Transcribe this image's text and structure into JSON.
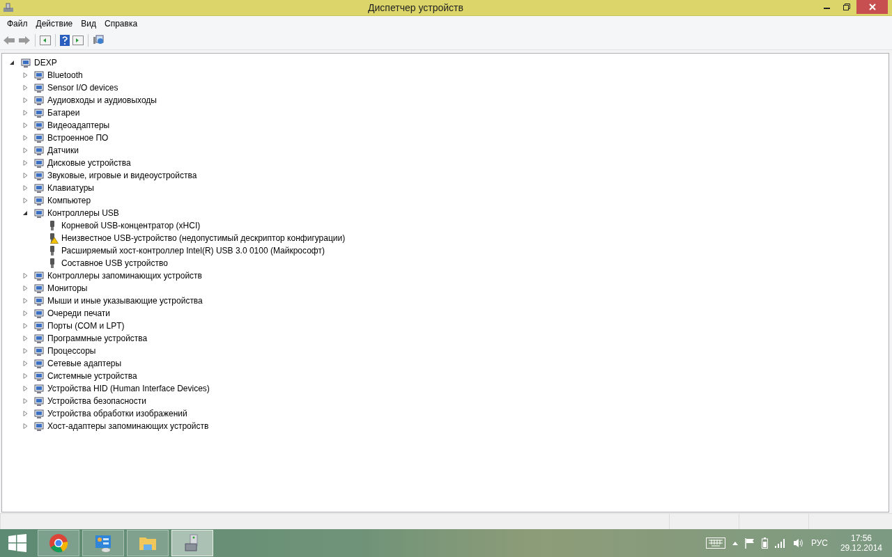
{
  "window": {
    "title": "Диспетчер устройств"
  },
  "menu": [
    "Файл",
    "Действие",
    "Вид",
    "Справка"
  ],
  "tree": {
    "label": "DEXP",
    "expanded": true,
    "children": [
      {
        "label": "Bluetooth",
        "expanded": false
      },
      {
        "label": "Sensor I/O devices",
        "expanded": false
      },
      {
        "label": "Аудиовходы и аудиовыходы",
        "expanded": false
      },
      {
        "label": "Батареи",
        "expanded": false
      },
      {
        "label": "Видеоадаптеры",
        "expanded": false
      },
      {
        "label": "Встроенное ПО",
        "expanded": false
      },
      {
        "label": "Датчики",
        "expanded": false
      },
      {
        "label": "Дисковые устройства",
        "expanded": false
      },
      {
        "label": "Звуковые, игровые и видеоустройства",
        "expanded": false
      },
      {
        "label": "Клавиатуры",
        "expanded": false
      },
      {
        "label": "Компьютер",
        "expanded": false
      },
      {
        "label": "Контроллеры USB",
        "expanded": true,
        "children": [
          {
            "label": "Корневой USB-концентратор (xHCI)",
            "warning": false
          },
          {
            "label": "Неизвестное USB-устройство (недопустимый дескриптор конфигурации)",
            "warning": true
          },
          {
            "label": "Расширяемый хост-контроллер Intel(R) USB 3.0 0100 (Майкрософт)",
            "warning": false
          },
          {
            "label": "Составное USB устройство",
            "warning": false
          }
        ]
      },
      {
        "label": "Контроллеры запоминающих устройств",
        "expanded": false
      },
      {
        "label": "Мониторы",
        "expanded": false
      },
      {
        "label": "Мыши и иные указывающие устройства",
        "expanded": false
      },
      {
        "label": "Очереди печати",
        "expanded": false
      },
      {
        "label": "Порты (COM и LPT)",
        "expanded": false
      },
      {
        "label": "Программные устройства",
        "expanded": false
      },
      {
        "label": "Процессоры",
        "expanded": false
      },
      {
        "label": "Сетевые адаптеры",
        "expanded": false
      },
      {
        "label": "Системные устройства",
        "expanded": false
      },
      {
        "label": "Устройства HID (Human Interface Devices)",
        "expanded": false
      },
      {
        "label": "Устройства безопасности",
        "expanded": false
      },
      {
        "label": "Устройства обработки изображений",
        "expanded": false
      },
      {
        "label": "Хост-адаптеры запоминающих устройств",
        "expanded": false
      }
    ]
  },
  "taskbar": {
    "apps": [
      {
        "selected": false
      },
      {
        "selected": false
      },
      {
        "selected": false
      },
      {
        "selected": true
      }
    ],
    "language": "РУС",
    "time": "17:56",
    "date": "29.12.2014"
  }
}
